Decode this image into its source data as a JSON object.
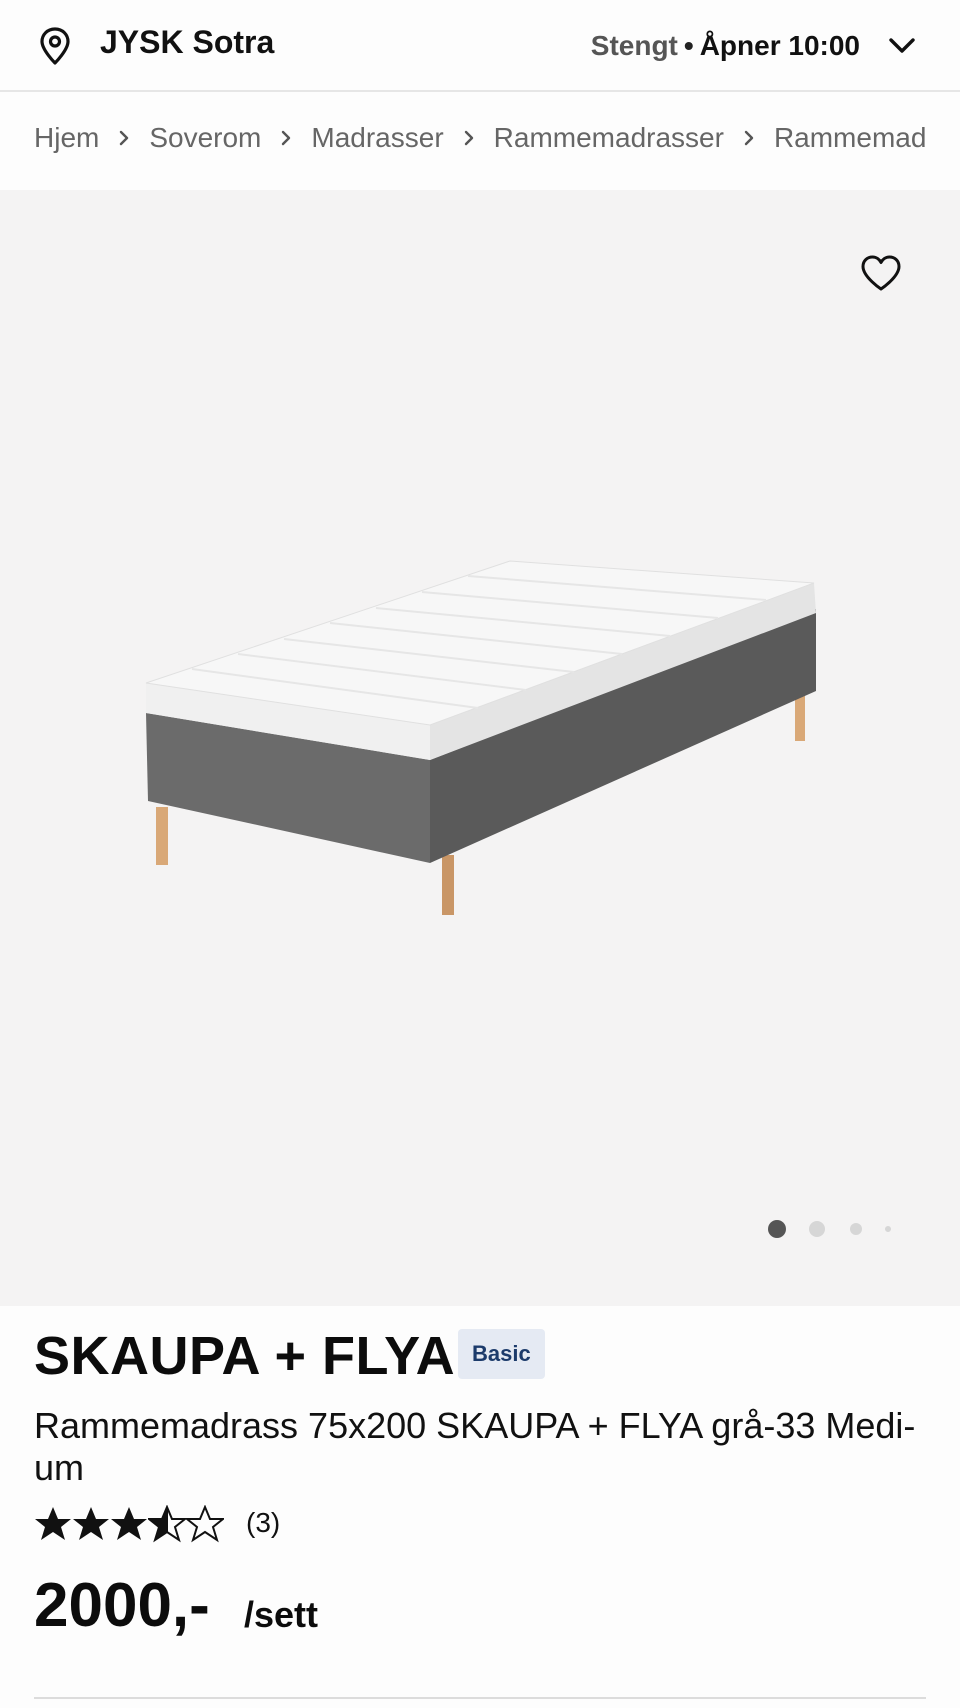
{
  "header": {
    "store_name": "JYSK Sotra",
    "status_closed": "Stengt",
    "status_separator": "•",
    "status_opens": "Åpner 10:00",
    "icons": [
      "location-pin-icon",
      "chevron-down-icon"
    ]
  },
  "breadcrumb": {
    "items": [
      "Hjem",
      "Soverom",
      "Madrasser",
      "Rammemadrasser",
      "Rammemadrasser"
    ],
    "separator_icon": "chevron-right-icon"
  },
  "gallery": {
    "favorite_icon": "heart-icon",
    "image_count": 4,
    "active_index": 0
  },
  "product": {
    "title": "SKAUPA + FLYA",
    "badge": "Basic",
    "subtitle": "Rammemadrass 75x200 SKAUPA + FLYA grå-33 Medi-um",
    "rating": 3.5,
    "rating_max": 5,
    "review_count": "(3)",
    "price": "2000,-",
    "unit": "/sett"
  },
  "colors": {
    "text": "#111111",
    "muted": "#666666",
    "gallery_bg": "#f4f3f3",
    "badge_bg": "#e5eaf3",
    "badge_text": "#1c3b6b"
  }
}
